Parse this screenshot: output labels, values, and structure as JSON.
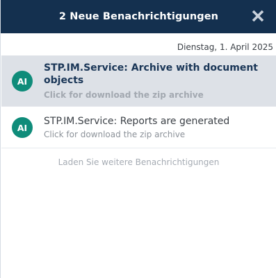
{
  "header": {
    "title": "2 Neue Benachrichtigungen",
    "close_icon": "close-icon",
    "background_color": "#14304f"
  },
  "date_label": "Dienstag, 1. April 2025",
  "notifications": [
    {
      "avatar_initials": "AI",
      "title": "STP.IM.Service: Archive with document objects",
      "subtitle": "Click for download the zip archive",
      "unread": true
    },
    {
      "avatar_initials": "AI",
      "title": "STP.IM.Service: Reports are generated",
      "subtitle": "Click for download the zip archive",
      "unread": false
    }
  ],
  "load_more_label": "Laden Sie weitere Benachrichtigungen",
  "colors": {
    "avatar": "#0f8c7a",
    "unread_background": "#dde1e7"
  }
}
